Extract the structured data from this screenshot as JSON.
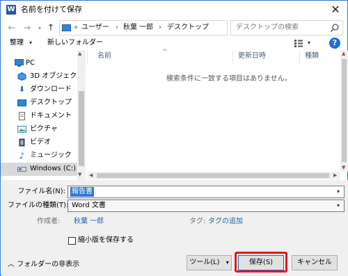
{
  "window": {
    "title": "名前を付けて保存",
    "app_icon": "word-icon",
    "close_glyph": "✕"
  },
  "nav_buttons": {
    "back": "←",
    "forward": "→",
    "up": "↑"
  },
  "address": {
    "overflow": "«",
    "segments": [
      "ユーザー",
      "秋葉 一郎",
      "デスクトップ"
    ],
    "separator": "›"
  },
  "search": {
    "placeholder": "デスクトップの検索"
  },
  "toolbar": {
    "organize": "整理",
    "new_folder": "新しいフォルダー",
    "help": "?"
  },
  "sidebar": {
    "items": [
      {
        "label": "PC",
        "icon": "pc-icon"
      },
      {
        "label": "3D オブジェクト",
        "icon": "3d-objects-icon"
      },
      {
        "label": "ダウンロード",
        "icon": "download-icon"
      },
      {
        "label": "デスクトップ",
        "icon": "desktop-icon"
      },
      {
        "label": "ドキュメント",
        "icon": "documents-icon"
      },
      {
        "label": "ピクチャ",
        "icon": "pictures-icon"
      },
      {
        "label": "ビデオ",
        "icon": "video-icon"
      },
      {
        "label": "ミュージック",
        "icon": "music-icon"
      },
      {
        "label": "Windows (C:)",
        "icon": "drive-icon",
        "selected": true
      }
    ]
  },
  "file_list": {
    "columns": [
      "名前",
      "更新日時",
      "種類"
    ],
    "empty_message": "検索条件に一致する項目はありません。"
  },
  "form": {
    "filename_label": "ファイル名(N):",
    "filename_value": "報告書",
    "filetype_label": "ファイルの種類(T):",
    "filetype_value": "Word 文書",
    "author_label": "作成者:",
    "author_value": "秋葉 一郎",
    "tags_label": "タグ:",
    "tags_value": "タグの追加",
    "thumbnail_label": "縮小版を保存する"
  },
  "footer": {
    "hide_folders": "フォルダーの非表示",
    "tools": "ツール(L)",
    "save": "保存(S)",
    "cancel": "キャンセル"
  },
  "colors": {
    "accent": "#0078d7",
    "highlight": "#e8141e",
    "selection": "#3478d5"
  }
}
